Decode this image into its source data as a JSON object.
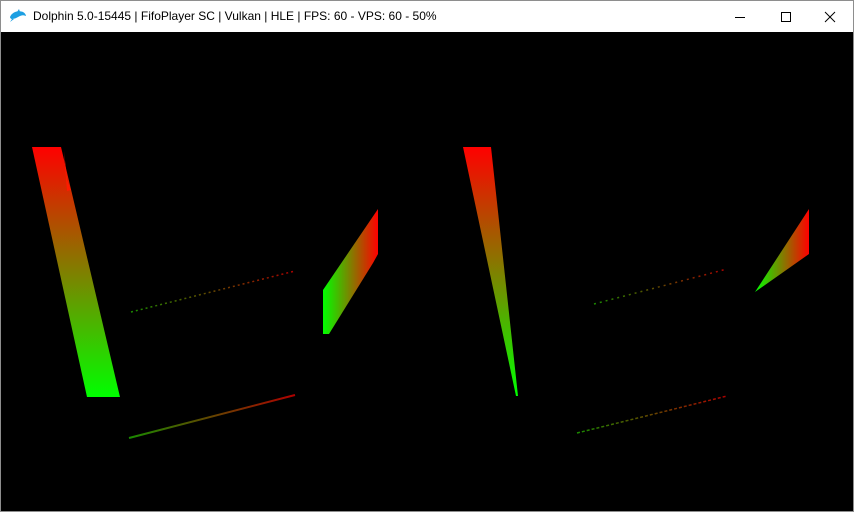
{
  "window": {
    "title": "Dolphin 5.0-15445 | FifoPlayer SC | Vulkan | HLE | FPS: 60 - VPS: 60 - 50%",
    "icon": "dolphin-icon",
    "buttons": {
      "minimize": "minimize-icon",
      "maximize": "maximize-icon",
      "close": "close-icon"
    }
  },
  "render": {
    "background": "#000000",
    "colors": {
      "red": "#ff0000",
      "green": "#00ff00",
      "accent": "#1d9fe2"
    }
  }
}
